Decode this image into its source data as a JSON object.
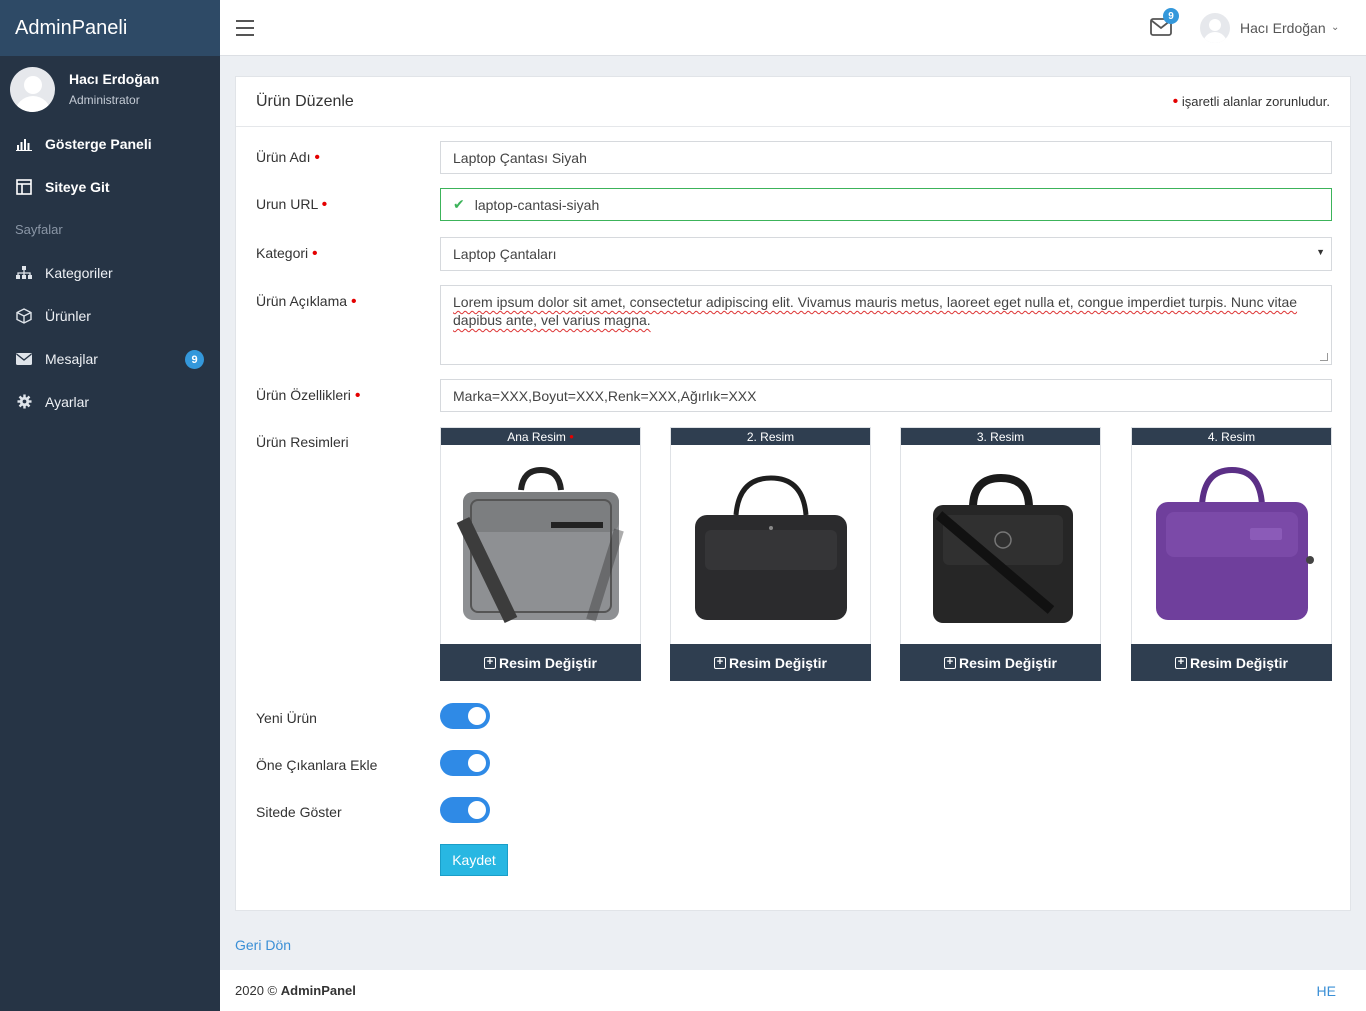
{
  "app": {
    "brand": "AdminPaneli"
  },
  "user": {
    "name": "Hacı Erdoğan",
    "role": "Administrator"
  },
  "sidebar": {
    "items": [
      {
        "label": "Gösterge Paneli",
        "icon": "bar-chart-icon"
      },
      {
        "label": "Siteye Git",
        "icon": "layout-icon"
      }
    ],
    "section": "Sayfalar",
    "pages": [
      {
        "label": "Kategoriler",
        "icon": "sitemap-icon"
      },
      {
        "label": "Ürünler",
        "icon": "cube-icon"
      },
      {
        "label": "Mesajlar",
        "icon": "envelope-icon",
        "badge": "9"
      },
      {
        "label": "Ayarlar",
        "icon": "gear-icon"
      }
    ]
  },
  "topbar": {
    "mail_badge": "9",
    "user_name": "Hacı Erdoğan"
  },
  "panel": {
    "title": "Ürün Düzenle",
    "required_note": "işaretli alanlar zorunludur."
  },
  "form": {
    "name_label": "Ürün Adı",
    "name_value": "Laptop Çantası Siyah",
    "url_label": "Urun URL",
    "url_value": "laptop-cantasi-siyah",
    "category_label": "Kategori",
    "category_value": "Laptop Çantaları",
    "description_label": "Ürün Açıklama",
    "description_value": "Lorem ipsum dolor sit amet, consectetur adipiscing elit. Vivamus mauris metus, laoreet eget nulla et, congue imperdiet turpis. Nunc vitae dapibus ante, vel varius magna.",
    "features_label": "Ürün Özellikleri",
    "features_value": "Marka=XXX,Boyut=XXX,Renk=XXX,Ağırlık=XXX",
    "images_label": "Ürün Resimleri",
    "images": [
      {
        "title": "Ana Resim",
        "button": "Resim Değiştir",
        "color": "#8c8e90"
      },
      {
        "title": "2. Resim",
        "button": "Resim Değiştir",
        "color": "#2b2b2d"
      },
      {
        "title": "3. Resim",
        "button": "Resim Değiştir",
        "color": "#262626"
      },
      {
        "title": "4. Resim",
        "button": "Resim Değiştir",
        "color": "#6f3f9c"
      }
    ],
    "new_product_label": "Yeni Ürün",
    "featured_label": "Öne Çıkanlara Ekle",
    "show_on_site_label": "Sitede Göster",
    "save_label": "Kaydet"
  },
  "back_link": "Geri Dön",
  "footer": {
    "year": "2020 ©",
    "brand": "AdminPanel",
    "right": "HE"
  },
  "colors": {
    "sidebar": "#263445",
    "brand": "#2e4a66",
    "accent": "#2f8ae6",
    "save": "#28b7e2",
    "valid": "#3cb35a"
  }
}
